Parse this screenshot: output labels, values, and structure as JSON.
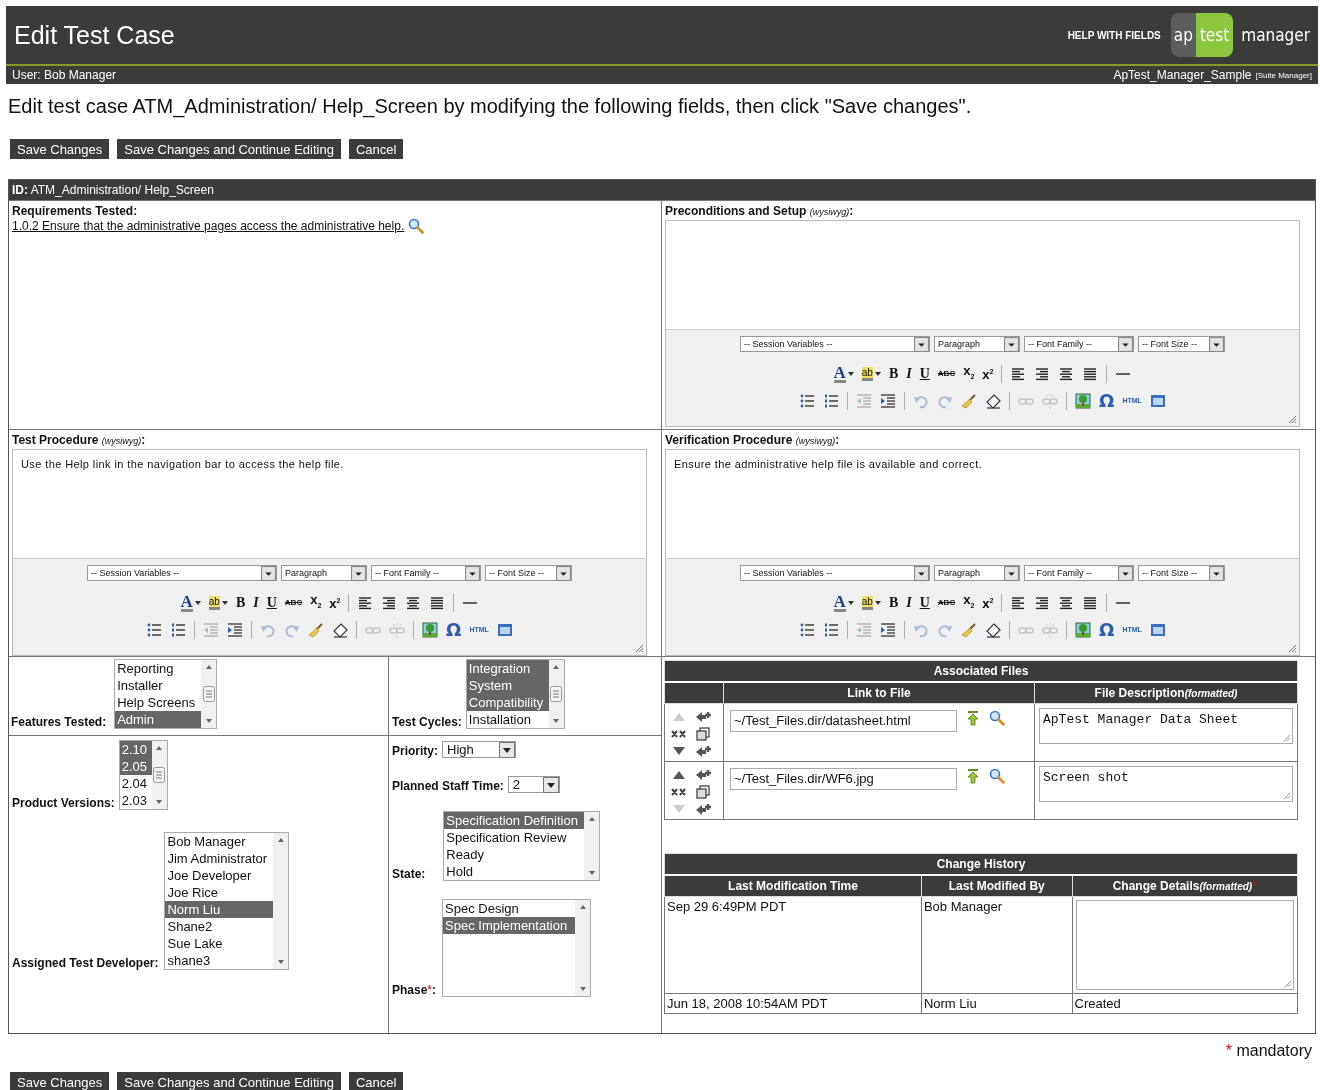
{
  "header": {
    "title": "Edit Test Case",
    "help_link": "HELP WITH FIELDS",
    "logo": [
      "ap",
      "test",
      "manager"
    ],
    "user": "User: Bob Manager",
    "project": "ApTest_Manager_Sample",
    "project_role": "[Suite Manager]"
  },
  "intro": "Edit test case ATM_Administration/ Help_Screen by modifying the following fields, then click \"Save changes\".",
  "top_buttons": [
    "Save Changes",
    "Save Changes and Continue Editing",
    "Cancel"
  ],
  "id_bar": "**ID:** ATM_Administration/ Help_Screen",
  "requirements": {
    "label": "Requirements Tested:",
    "link": "1.0.2 Ensure that the administrative pages access the administrative help."
  },
  "editors": [
    {
      "label": "Preconditions and Setup",
      "hint": "(wysiwyg)",
      "end": ":",
      "toolbar": {
        "selects": [
          "-- Session Variables --",
          "Paragraph",
          "-- Font Family --",
          "-- Font Size --"
        ],
        "rows": [
          [
            [
              {
                "kind": "text-color",
                "label": "A",
                "disabled": false
              },
              {
                "kind": "highlight",
                "label": "ab",
                "disabled": false
              },
              {
                "kind": "bold",
                "label": "B",
                "disabled": false
              },
              {
                "kind": "italic",
                "label": "I",
                "disabled": false
              },
              {
                "kind": "underline",
                "label": "U",
                "disabled": false
              },
              {
                "kind": "strike",
                "label": "ABC",
                "disabled": false
              },
              {
                "kind": "subscript",
                "label": "x$_{2}$",
                "disabled": false
              },
              {
                "kind": "superscript",
                "label": "x$^{2}$",
                "disabled": false
              }
            ],
            [
              {
                "kind": "align-left",
                "disabled": false
              },
              {
                "kind": "align-right",
                "disabled": false
              },
              {
                "kind": "align-center",
                "disabled": false
              },
              {
                "kind": "justify",
                "disabled": false
              }
            ],
            [
              {
                "kind": "rule",
                "disabled": false
              }
            ]
          ],
          [
            [
              {
                "kind": "bullets",
                "disabled": false
              },
              {
                "kind": "numbering",
                "disabled": false
              }
            ],
            [
              {
                "kind": "outdent",
                "disabled": true
              },
              {
                "kind": "indent",
                "disabled": false
              }
            ],
            [
              {
                "kind": "undo",
                "disabled": true
              },
              {
                "kind": "redo",
                "disabled": true
              },
              {
                "kind": "cleanup",
                "disabled": false
              },
              {
                "kind": "eraser",
                "disabled": false
              }
            ],
            [
              {
                "kind": "link",
                "disabled": true
              },
              {
                "kind": "unlink",
                "disabled": true
              }
            ],
            [
              {
                "kind": "image",
                "disabled": false
              },
              {
                "kind": "special-char",
                "label": "Ω",
                "disabled": false
              },
              {
                "kind": "html",
                "label": "HTML",
                "disabled": false
              },
              {
                "kind": "fullscreen",
                "disabled": false
              }
            ]
          ]
        ]
      }
    },
    {
      "label": "Test Procedure",
      "hint": "(wysiwyg)",
      "end": ":",
      "content": "Use the Help link in the navigation bar to access the help file.",
      "toolbar": {
        "selects": [
          "-- Session Variables --",
          "Paragraph",
          "-- Font Family --",
          "-- Font Size --"
        ],
        "rows": [
          [
            [
              {
                "kind": "text-color",
                "label": "A",
                "disabled": false
              },
              {
                "kind": "highlight",
                "label": "ab",
                "disabled": false
              },
              {
                "kind": "bold",
                "label": "B",
                "disabled": false
              },
              {
                "kind": "italic",
                "label": "I",
                "disabled": false
              },
              {
                "kind": "underline",
                "label": "U",
                "disabled": false
              },
              {
                "kind": "strike",
                "label": "ABC",
                "disabled": false
              },
              {
                "kind": "subscript",
                "label": "x$_{2}$",
                "disabled": false
              },
              {
                "kind": "superscript",
                "label": "x$^{2}$",
                "disabled": false
              }
            ],
            [
              {
                "kind": "align-left",
                "disabled": false
              },
              {
                "kind": "align-right",
                "disabled": false
              },
              {
                "kind": "align-center",
                "disabled": false
              },
              {
                "kind": "justify",
                "disabled": false
              }
            ],
            [
              {
                "kind": "rule",
                "disabled": false
              }
            ]
          ],
          [
            [
              {
                "kind": "bullets",
                "disabled": false
              },
              {
                "kind": "numbering",
                "disabled": false
              }
            ],
            [
              {
                "kind": "outdent",
                "disabled": true
              },
              {
                "kind": "indent",
                "disabled": false
              }
            ],
            [
              {
                "kind": "undo",
                "disabled": true
              },
              {
                "kind": "redo",
                "disabled": true
              },
              {
                "kind": "cleanup",
                "disabled": false
              },
              {
                "kind": "eraser",
                "disabled": false
              }
            ],
            [
              {
                "kind": "link",
                "disabled": true
              },
              {
                "kind": "unlink",
                "disabled": true
              }
            ],
            [
              {
                "kind": "image",
                "disabled": false
              },
              {
                "kind": "special-char",
                "label": "Ω",
                "disabled": false
              },
              {
                "kind": "html",
                "label": "HTML",
                "disabled": false
              },
              {
                "kind": "fullscreen",
                "disabled": false
              }
            ]
          ]
        ]
      }
    },
    {
      "label": "Verification Procedure",
      "hint": "(wysiwyg)",
      "end": ":",
      "content": "Ensure the administrative help file is available and correct.",
      "toolbar": {
        "selects": [
          "-- Session Variables --",
          "Paragraph",
          "-- Font Family --",
          "-- Font Size --"
        ],
        "rows": [
          [
            [
              {
                "kind": "text-color",
                "label": "A",
                "disabled": false
              },
              {
                "kind": "highlight",
                "label": "ab",
                "disabled": false
              },
              {
                "kind": "bold",
                "label": "B",
                "disabled": false
              },
              {
                "kind": "italic",
                "label": "I",
                "disabled": false
              },
              {
                "kind": "underline",
                "label": "U",
                "disabled": false
              },
              {
                "kind": "strike",
                "label": "ABC",
                "disabled": false
              },
              {
                "kind": "subscript",
                "label": "x$_{2}$",
                "disabled": false
              },
              {
                "kind": "superscript",
                "label": "x$^{2}$",
                "disabled": false
              }
            ],
            [
              {
                "kind": "align-left",
                "disabled": false
              },
              {
                "kind": "align-right",
                "disabled": false
              },
              {
                "kind": "align-center",
                "disabled": false
              },
              {
                "kind": "justify",
                "disabled": false
              }
            ],
            [
              {
                "kind": "rule",
                "disabled": false
              }
            ]
          ],
          [
            [
              {
                "kind": "bullets",
                "disabled": false
              },
              {
                "kind": "numbering",
                "disabled": false
              }
            ],
            [
              {
                "kind": "outdent",
                "disabled": true
              },
              {
                "kind": "indent",
                "disabled": false
              }
            ],
            [
              {
                "kind": "undo",
                "disabled": true
              },
              {
                "kind": "redo",
                "disabled": true
              },
              {
                "kind": "cleanup",
                "disabled": false
              },
              {
                "kind": "eraser",
                "disabled": false
              }
            ],
            [
              {
                "kind": "link",
                "disabled": true
              },
              {
                "kind": "unlink",
                "disabled": true
              }
            ],
            [
              {
                "kind": "image",
                "disabled": false
              },
              {
                "kind": "special-char",
                "label": "Ω",
                "disabled": false
              },
              {
                "kind": "html",
                "label": "HTML",
                "disabled": false
              },
              {
                "kind": "fullscreen",
                "disabled": false
              }
            ]
          ]
        ]
      }
    }
  ],
  "features": {
    "label": "Features Tested:",
    "options": [
      {
        "text": "Reporting",
        "selected": false
      },
      {
        "text": "Installer",
        "selected": false
      },
      {
        "text": "Help Screens",
        "selected": false
      },
      {
        "text": "Admin",
        "selected": true
      }
    ]
  },
  "test_cycles": {
    "label": "Test Cycles:",
    "options": [
      {
        "text": "Integration",
        "selected": true
      },
      {
        "text": "System",
        "selected": true
      },
      {
        "text": "Compatibility",
        "selected": true
      },
      {
        "text": "Installation",
        "selected": false
      }
    ]
  },
  "product_versions": {
    "label": "Product Versions:",
    "options": [
      {
        "text": "2.10",
        "selected": true
      },
      {
        "text": "2.05",
        "selected": true
      },
      {
        "text": "2.04",
        "selected": false
      },
      {
        "text": "2.03",
        "selected": false
      }
    ]
  },
  "developer": {
    "label": "Assigned Test Developer:",
    "options": [
      {
        "text": "Bob Manager",
        "selected": false
      },
      {
        "text": "Jim Administrator",
        "selected": false
      },
      {
        "text": "Joe Developer",
        "selected": false
      },
      {
        "text": "Joe Rice",
        "selected": false
      },
      {
        "text": "Norm Liu",
        "selected": true
      },
      {
        "text": "Shane2",
        "selected": false
      },
      {
        "text": "Sue Lake",
        "selected": false
      },
      {
        "text": "shane3",
        "selected": false
      }
    ]
  },
  "priority": {
    "label": "Priority:",
    "value": "High"
  },
  "staff_time": {
    "label": "Planned Staff Time:",
    "value": "2"
  },
  "state": {
    "label": "State:",
    "options": [
      {
        "text": "Specification Definition",
        "selected": true
      },
      {
        "text": "Specification Review",
        "selected": false
      },
      {
        "text": "Ready",
        "selected": false
      },
      {
        "text": "Hold",
        "selected": false
      }
    ]
  },
  "phase": {
    "label": "Phase",
    "mark": "*",
    "end": ":",
    "options": [
      {
        "text": "Spec Design",
        "selected": false
      },
      {
        "text": "Spec Implementation",
        "selected": true
      }
    ]
  },
  "associated_files": {
    "title": "Associated Files",
    "columns": [
      {
        "text": "Link to File"
      },
      {
        "text": "File Description",
        "note": "(formatted)"
      }
    ],
    "rows": [
      {
        "path": "~/Test_Files.dir/datasheet.html",
        "description": "ApTest Manager Data Sheet",
        "can_move_up": false,
        "can_move_down": true
      },
      {
        "path": "~/Test_Files.dir/WF6.jpg",
        "description": "Screen shot",
        "can_move_up": true,
        "can_move_down": false
      }
    ]
  },
  "change_history": {
    "title": "Change History",
    "columns": [
      {
        "text": "Last Modification Time"
      },
      {
        "text": "Last Modified By"
      },
      {
        "text": "Change Details",
        "note": "(formatted)",
        "mark": "*"
      }
    ],
    "rows": [
      {
        "time": "Sep 29 6:49PM PDT",
        "by": "Bob Manager",
        "kind": "input"
      },
      {
        "time": "Jun 18, 2008 10:54AM PDT",
        "by": "Norm Liu",
        "kind": "text",
        "details": "Created"
      }
    ]
  },
  "mandatory": {
    "mark": "*",
    "text": "mandatory"
  },
  "bottom_buttons": [
    "Save Changes",
    "Save Changes and Continue Editing",
    "Cancel"
  ]
}
